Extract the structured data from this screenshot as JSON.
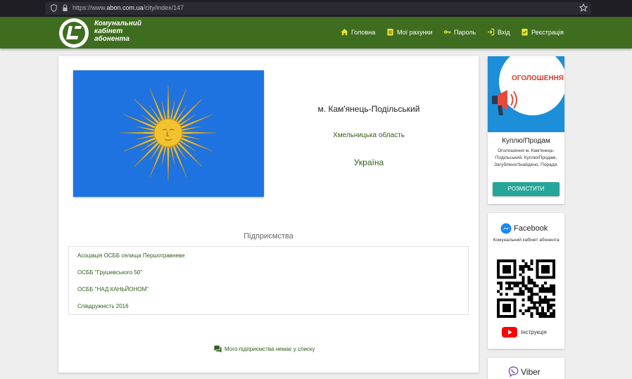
{
  "browser": {
    "url_prefix": "https://www.",
    "url_domain": "abon.com.ua",
    "url_path": "/city/index/147"
  },
  "navbar": {
    "logo_line1": "Комунальний",
    "logo_line2": "кабінет",
    "logo_line3": "абонента",
    "items": [
      {
        "label": "Головна",
        "icon": "home-icon"
      },
      {
        "label": "Мої рахунки",
        "icon": "clipboard-icon"
      },
      {
        "label": "Пароль",
        "icon": "key-icon"
      },
      {
        "label": "Вхід",
        "icon": "login-icon"
      },
      {
        "label": "Реєстрація",
        "icon": "check-clipboard-icon"
      }
    ]
  },
  "city": {
    "name": "м. Кам'янець-Подільський",
    "region": "Хмельницька область",
    "country": "Україна"
  },
  "enterprises": {
    "title": "Підприємства",
    "items": [
      "Асоціація ОСББ селища Першотравневе",
      "ОСББ \"Грушевського 50\"",
      "ОСББ \"НАД КАНЬЙОНОМ\"",
      "Співдружність 2016"
    ],
    "missing_link": "Мого підприємства немає у списку"
  },
  "ad": {
    "banner_text": "ОГОЛОШЕННЯ",
    "title": "Куплю/Продам",
    "text": "Оголошення м. Кам'янець-Подільський: Куплю/Продам, Загублено/Знайдено, Поради.",
    "button": "РОЗМІСТИТИ"
  },
  "facebook": {
    "title": "Facebook",
    "subtitle": "Комунальний кабінет абонента",
    "youtube_label": "Інструкція"
  },
  "viber": {
    "title": "Viber"
  },
  "colors": {
    "navbar": "#3e6d1f",
    "link_green": "#2e5e16",
    "flag_blue": "#1f73e0",
    "sun_gold": "#f2c230",
    "button_teal": "#26a69a"
  }
}
